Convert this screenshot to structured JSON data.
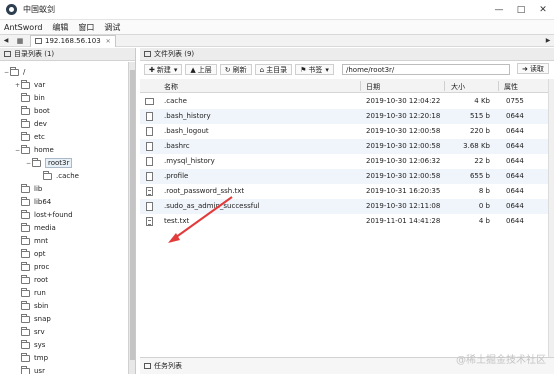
{
  "app": {
    "title": "中国蚁剑"
  },
  "menu": [
    "AntSword",
    "编辑",
    "窗口",
    "调试"
  ],
  "tab": {
    "label": "192.168.56.103"
  },
  "left_panel": {
    "header": "目录列表 (1)",
    "tree": [
      {
        "label": "/",
        "depth": 0,
        "expand": "−"
      },
      {
        "label": "var",
        "depth": 1,
        "expand": "+"
      },
      {
        "label": "bin",
        "depth": 1,
        "expand": ""
      },
      {
        "label": "boot",
        "depth": 1,
        "expand": ""
      },
      {
        "label": "dev",
        "depth": 1,
        "expand": ""
      },
      {
        "label": "etc",
        "depth": 1,
        "expand": ""
      },
      {
        "label": "home",
        "depth": 1,
        "expand": "−"
      },
      {
        "label": "root3r",
        "depth": 2,
        "expand": "−",
        "selected": true
      },
      {
        "label": ".cache",
        "depth": 3,
        "expand": ""
      },
      {
        "label": "lib",
        "depth": 1,
        "expand": ""
      },
      {
        "label": "lib64",
        "depth": 1,
        "expand": ""
      },
      {
        "label": "lost+found",
        "depth": 1,
        "expand": ""
      },
      {
        "label": "media",
        "depth": 1,
        "expand": ""
      },
      {
        "label": "mnt",
        "depth": 1,
        "expand": ""
      },
      {
        "label": "opt",
        "depth": 1,
        "expand": ""
      },
      {
        "label": "proc",
        "depth": 1,
        "expand": ""
      },
      {
        "label": "root",
        "depth": 1,
        "expand": ""
      },
      {
        "label": "run",
        "depth": 1,
        "expand": ""
      },
      {
        "label": "sbin",
        "depth": 1,
        "expand": ""
      },
      {
        "label": "snap",
        "depth": 1,
        "expand": ""
      },
      {
        "label": "srv",
        "depth": 1,
        "expand": ""
      },
      {
        "label": "sys",
        "depth": 1,
        "expand": ""
      },
      {
        "label": "tmp",
        "depth": 1,
        "expand": ""
      },
      {
        "label": "usr",
        "depth": 1,
        "expand": ""
      }
    ]
  },
  "right_panel": {
    "header": "文件列表 (9)",
    "toolbar": {
      "new_label": "新建",
      "up_label": "上层",
      "refresh_label": "刷新",
      "home_label": "主目录",
      "bookmark_label": "书签",
      "path_value": "/home/root3r/",
      "read_label": "读取"
    },
    "columns": [
      "名称",
      "日期",
      "大小",
      "属性"
    ],
    "files": [
      {
        "name": ".cache",
        "date": "2019-10-30 12:04:22",
        "size": "4 Kb",
        "perm": "0755",
        "type": "dir"
      },
      {
        "name": ".bash_history",
        "date": "2019-10-30 12:20:18",
        "size": "515 b",
        "perm": "0644",
        "type": "file"
      },
      {
        "name": ".bash_logout",
        "date": "2019-10-30 12:00:58",
        "size": "220 b",
        "perm": "0644",
        "type": "file"
      },
      {
        "name": ".bashrc",
        "date": "2019-10-30 12:00:58",
        "size": "3.68 Kb",
        "perm": "0644",
        "type": "file"
      },
      {
        "name": ".mysql_history",
        "date": "2019-10-30 12:06:32",
        "size": "22 b",
        "perm": "0644",
        "type": "file"
      },
      {
        "name": ".profile",
        "date": "2019-10-30 12:00:58",
        "size": "655 b",
        "perm": "0644",
        "type": "file"
      },
      {
        "name": ".root_password_ssh.txt",
        "date": "2019-10-31 16:20:35",
        "size": "8 b",
        "perm": "0644",
        "type": "txt"
      },
      {
        "name": ".sudo_as_admin_successful",
        "date": "2019-10-30 12:11:08",
        "size": "0 b",
        "perm": "0644",
        "type": "file"
      },
      {
        "name": "test.txt",
        "date": "2019-11-01 14:41:28",
        "size": "4 b",
        "perm": "0644",
        "type": "txt"
      }
    ],
    "status": "任务列表"
  },
  "watermark": "@稀土掘金技术社区",
  "colors": {
    "arrow": "#e23b3b",
    "row_alt": "#f0f5fb"
  }
}
